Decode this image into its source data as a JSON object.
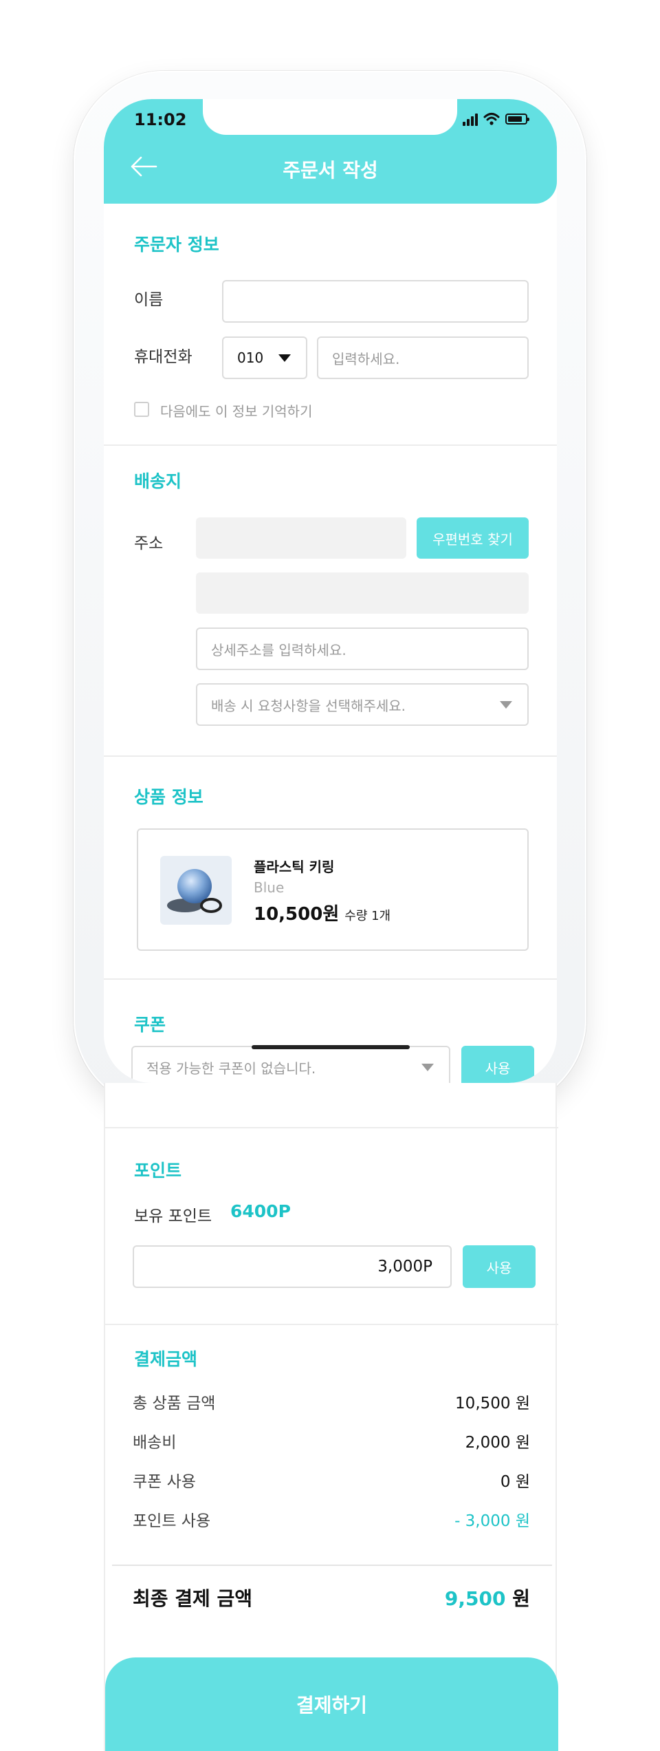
{
  "status_bar": {
    "time": "11:02"
  },
  "header": {
    "title": "주문서 작성"
  },
  "orderer": {
    "section_title": "주문자 정보",
    "name_label": "이름",
    "name_value": "",
    "phone_label": "휴대전화",
    "phone_prefix": "010",
    "phone_placeholder": "입력하세요.",
    "remember_label": "다음에도 이 정보 기억하기",
    "remember_checked": false
  },
  "shipping": {
    "section_title": "배송지",
    "address_label": "주소",
    "postcode_button": "우편번호 찾기",
    "detail_placeholder": "상세주소를 입력하세요.",
    "request_placeholder": "배송 시 요청사항을 선택해주세요."
  },
  "product": {
    "section_title": "상품 정보",
    "name": "플라스틱 키링",
    "option": "Blue",
    "price": "10,500원",
    "quantity": "수량 1개"
  },
  "coupon": {
    "section_title": "쿠폰",
    "placeholder": "적용 가능한 쿠폰이 없습니다.",
    "apply_button": "사용"
  },
  "points": {
    "section_title": "포인트",
    "owned_label": "보유 포인트",
    "owned_value": "6400P",
    "input_value": "3,000P",
    "apply_button": "사용"
  },
  "payment": {
    "section_title": "결제금액",
    "rows": [
      {
        "label": "총 상품 금액",
        "value": "10,500 원"
      },
      {
        "label": "배송비",
        "value": "2,000 원"
      },
      {
        "label": "쿠폰 사용",
        "value": "0 원"
      },
      {
        "label": "포인트 사용",
        "value": "- 3,000 원"
      }
    ],
    "final_label": "최종 결제 금액",
    "final_amount": "9,500",
    "final_unit": "원",
    "pay_button": "결제하기"
  },
  "colors": {
    "accent": "#63e0e2",
    "accent_text": "#1dc3c7"
  }
}
